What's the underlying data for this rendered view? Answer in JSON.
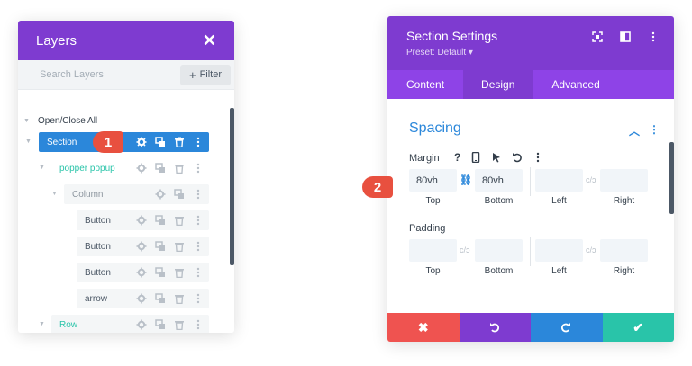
{
  "layers": {
    "title": "Layers",
    "search_placeholder": "Search Layers",
    "filter_label": "Filter",
    "open_close_all": "Open/Close All",
    "items": [
      {
        "label": "Section"
      },
      {
        "label": "popper popup"
      },
      {
        "label": "Column"
      },
      {
        "label": "Button"
      },
      {
        "label": "Button"
      },
      {
        "label": "Button"
      },
      {
        "label": "arrow"
      },
      {
        "label": "Row"
      }
    ]
  },
  "badges": {
    "one": "1",
    "two": "2"
  },
  "settings": {
    "title": "Section Settings",
    "preset": "Preset: Default ▾",
    "tabs": [
      "Content",
      "Design",
      "Advanced"
    ],
    "active_tab": "Design",
    "group_title": "Spacing",
    "margin": {
      "label": "Margin",
      "top": "80vh",
      "bottom": "80vh",
      "left": "",
      "right": "",
      "sub_labels": [
        "Top",
        "Bottom",
        "Left",
        "Right"
      ]
    },
    "padding": {
      "label": "Padding",
      "sub_labels": [
        "Top",
        "Bottom",
        "Left",
        "Right"
      ]
    }
  },
  "colors": {
    "header_purple": "#7e3bd0",
    "tab_purple": "#8e43e7",
    "section_blue": "#2b87da",
    "teal": "#29c4a9",
    "badge_red": "#e8503f",
    "cancel": "#ef5350",
    "undo": "#7e3bd0",
    "redo": "#2b87da",
    "save": "#29c4a9"
  }
}
